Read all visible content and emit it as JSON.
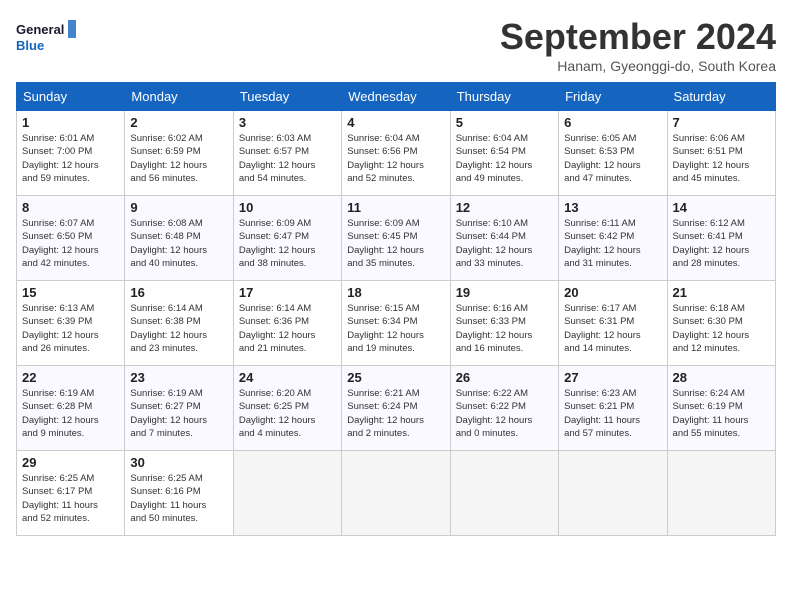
{
  "header": {
    "logo_line1": "General",
    "logo_line2": "Blue",
    "title": "September 2024",
    "location": "Hanam, Gyeonggi-do, South Korea"
  },
  "days_of_week": [
    "Sunday",
    "Monday",
    "Tuesday",
    "Wednesday",
    "Thursday",
    "Friday",
    "Saturday"
  ],
  "weeks": [
    [
      {
        "day": "1",
        "info": "Sunrise: 6:01 AM\nSunset: 7:00 PM\nDaylight: 12 hours\nand 59 minutes."
      },
      {
        "day": "2",
        "info": "Sunrise: 6:02 AM\nSunset: 6:59 PM\nDaylight: 12 hours\nand 56 minutes."
      },
      {
        "day": "3",
        "info": "Sunrise: 6:03 AM\nSunset: 6:57 PM\nDaylight: 12 hours\nand 54 minutes."
      },
      {
        "day": "4",
        "info": "Sunrise: 6:04 AM\nSunset: 6:56 PM\nDaylight: 12 hours\nand 52 minutes."
      },
      {
        "day": "5",
        "info": "Sunrise: 6:04 AM\nSunset: 6:54 PM\nDaylight: 12 hours\nand 49 minutes."
      },
      {
        "day": "6",
        "info": "Sunrise: 6:05 AM\nSunset: 6:53 PM\nDaylight: 12 hours\nand 47 minutes."
      },
      {
        "day": "7",
        "info": "Sunrise: 6:06 AM\nSunset: 6:51 PM\nDaylight: 12 hours\nand 45 minutes."
      }
    ],
    [
      {
        "day": "8",
        "info": "Sunrise: 6:07 AM\nSunset: 6:50 PM\nDaylight: 12 hours\nand 42 minutes."
      },
      {
        "day": "9",
        "info": "Sunrise: 6:08 AM\nSunset: 6:48 PM\nDaylight: 12 hours\nand 40 minutes."
      },
      {
        "day": "10",
        "info": "Sunrise: 6:09 AM\nSunset: 6:47 PM\nDaylight: 12 hours\nand 38 minutes."
      },
      {
        "day": "11",
        "info": "Sunrise: 6:09 AM\nSunset: 6:45 PM\nDaylight: 12 hours\nand 35 minutes."
      },
      {
        "day": "12",
        "info": "Sunrise: 6:10 AM\nSunset: 6:44 PM\nDaylight: 12 hours\nand 33 minutes."
      },
      {
        "day": "13",
        "info": "Sunrise: 6:11 AM\nSunset: 6:42 PM\nDaylight: 12 hours\nand 31 minutes."
      },
      {
        "day": "14",
        "info": "Sunrise: 6:12 AM\nSunset: 6:41 PM\nDaylight: 12 hours\nand 28 minutes."
      }
    ],
    [
      {
        "day": "15",
        "info": "Sunrise: 6:13 AM\nSunset: 6:39 PM\nDaylight: 12 hours\nand 26 minutes."
      },
      {
        "day": "16",
        "info": "Sunrise: 6:14 AM\nSunset: 6:38 PM\nDaylight: 12 hours\nand 23 minutes."
      },
      {
        "day": "17",
        "info": "Sunrise: 6:14 AM\nSunset: 6:36 PM\nDaylight: 12 hours\nand 21 minutes."
      },
      {
        "day": "18",
        "info": "Sunrise: 6:15 AM\nSunset: 6:34 PM\nDaylight: 12 hours\nand 19 minutes."
      },
      {
        "day": "19",
        "info": "Sunrise: 6:16 AM\nSunset: 6:33 PM\nDaylight: 12 hours\nand 16 minutes."
      },
      {
        "day": "20",
        "info": "Sunrise: 6:17 AM\nSunset: 6:31 PM\nDaylight: 12 hours\nand 14 minutes."
      },
      {
        "day": "21",
        "info": "Sunrise: 6:18 AM\nSunset: 6:30 PM\nDaylight: 12 hours\nand 12 minutes."
      }
    ],
    [
      {
        "day": "22",
        "info": "Sunrise: 6:19 AM\nSunset: 6:28 PM\nDaylight: 12 hours\nand 9 minutes."
      },
      {
        "day": "23",
        "info": "Sunrise: 6:19 AM\nSunset: 6:27 PM\nDaylight: 12 hours\nand 7 minutes."
      },
      {
        "day": "24",
        "info": "Sunrise: 6:20 AM\nSunset: 6:25 PM\nDaylight: 12 hours\nand 4 minutes."
      },
      {
        "day": "25",
        "info": "Sunrise: 6:21 AM\nSunset: 6:24 PM\nDaylight: 12 hours\nand 2 minutes."
      },
      {
        "day": "26",
        "info": "Sunrise: 6:22 AM\nSunset: 6:22 PM\nDaylight: 12 hours\nand 0 minutes."
      },
      {
        "day": "27",
        "info": "Sunrise: 6:23 AM\nSunset: 6:21 PM\nDaylight: 11 hours\nand 57 minutes."
      },
      {
        "day": "28",
        "info": "Sunrise: 6:24 AM\nSunset: 6:19 PM\nDaylight: 11 hours\nand 55 minutes."
      }
    ],
    [
      {
        "day": "29",
        "info": "Sunrise: 6:25 AM\nSunset: 6:17 PM\nDaylight: 11 hours\nand 52 minutes."
      },
      {
        "day": "30",
        "info": "Sunrise: 6:25 AM\nSunset: 6:16 PM\nDaylight: 11 hours\nand 50 minutes."
      },
      {
        "day": "",
        "info": ""
      },
      {
        "day": "",
        "info": ""
      },
      {
        "day": "",
        "info": ""
      },
      {
        "day": "",
        "info": ""
      },
      {
        "day": "",
        "info": ""
      }
    ]
  ]
}
